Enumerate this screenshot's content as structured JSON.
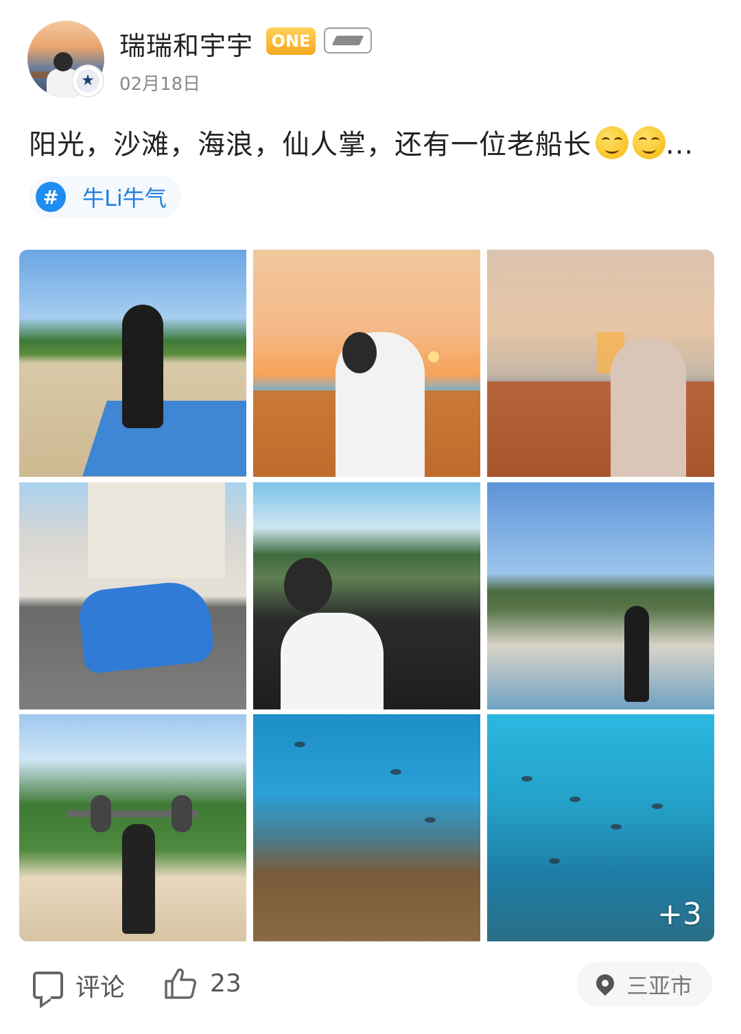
{
  "user": {
    "name": "瑞瑞和宇宇",
    "badge": "ONE",
    "date": "02月18日"
  },
  "post": {
    "text": "阳光，沙滩，海浪，仙人掌，还有一位老船长",
    "emojis": [
      "smiling-face",
      "smiling-face"
    ],
    "ellipsis": "...",
    "topic": "牛Li牛气"
  },
  "photos": {
    "items": [
      "beach-woman-sitting",
      "sunset-man-boat",
      "sunset-woman-boat",
      "blue-convertible-street",
      "man-driving-convertible",
      "woman-on-shore",
      "man-lifting-prop-barbell",
      "coral-reef",
      "fish-school"
    ],
    "more_count": "+3"
  },
  "actions": {
    "comment_label": "评论",
    "like_count": "23",
    "location": "三亚市"
  },
  "colors": {
    "topic_blue": "#1f7ee0",
    "badge_gold": "#f4a91e"
  }
}
